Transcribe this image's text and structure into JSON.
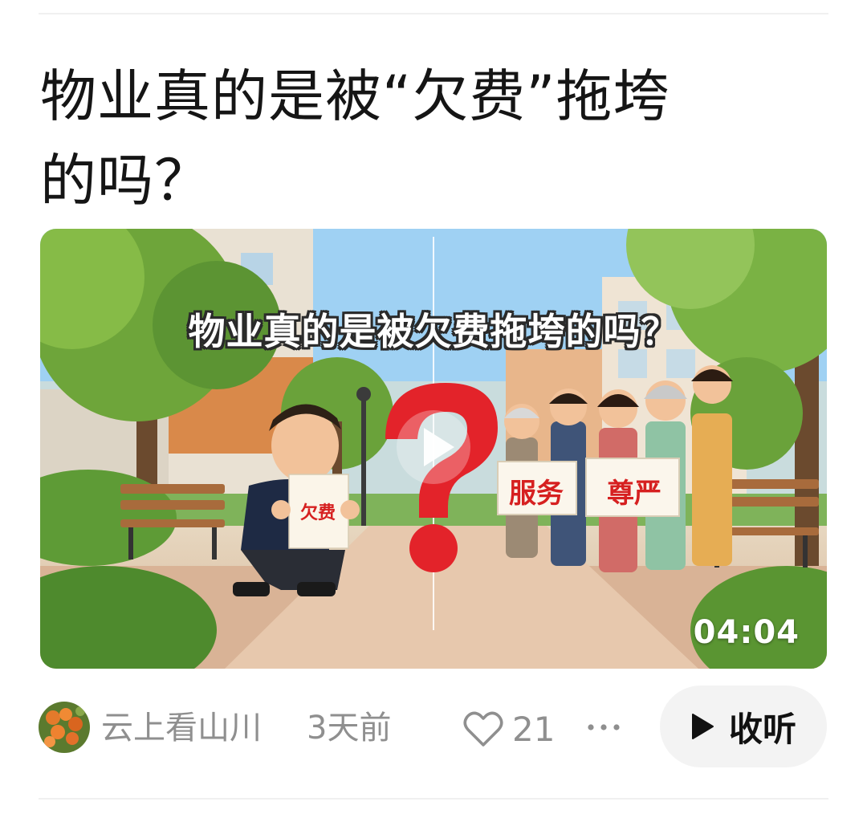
{
  "article": {
    "title": "物业真的是被“欠费”拖垮的吗？"
  },
  "video": {
    "headline": "物业真的是被欠费拖垮的吗？",
    "duration": "04:04",
    "sign_left": "欠费",
    "sign_service": "服务",
    "sign_dignity": "尊严",
    "play_icon": "play-icon"
  },
  "footer": {
    "author": "云上看山川",
    "time": "3天前",
    "likes": "21",
    "like_icon": "heart-icon",
    "more_icon": "more-icon",
    "listen_label": "收听",
    "listen_icon": "play-icon"
  }
}
